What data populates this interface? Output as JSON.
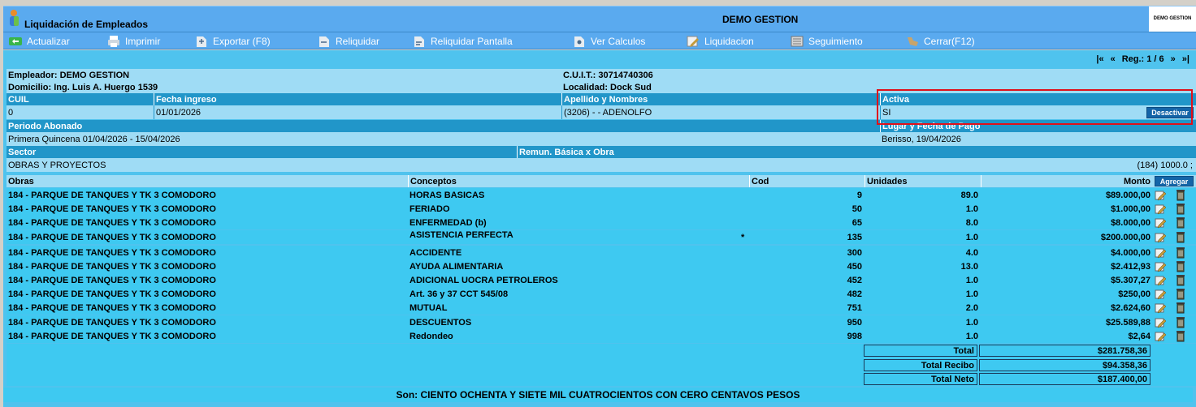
{
  "header": {
    "app_title": "Liquidación de Empleados",
    "company": "DEMO GESTION",
    "brand": "DEMO GESTION"
  },
  "toolbar": {
    "items": [
      {
        "label": "Actualizar",
        "icon": "refresh-icon"
      },
      {
        "label": "Imprimir",
        "icon": "print-icon"
      },
      {
        "label": "Exportar (F8)",
        "icon": "export-icon"
      },
      {
        "label": "Reliquidar",
        "icon": "reliquidar-icon"
      },
      {
        "label": "Reliquidar Pantalla",
        "icon": "reliquidar-screen-icon"
      },
      {
        "label": "Ver Calculos",
        "icon": "calc-icon"
      },
      {
        "label": "Liquidacion",
        "icon": "edit-icon"
      },
      {
        "label": "Seguimiento",
        "icon": "tracking-icon"
      },
      {
        "label": "Cerrar(F12)",
        "icon": "close-icon"
      }
    ]
  },
  "nav": {
    "first": "|«",
    "prev": "«",
    "reg_label": "Reg.: 1 / 6",
    "next": "»",
    "last": "»|"
  },
  "employer": {
    "empleador": "Empleador: DEMO GESTION",
    "domicilio": "Domicilio: Ing. Luis A. Huergo 1539",
    "cuit": "C.U.I.T.: 30714740306",
    "localidad": "Localidad: Dock Sud"
  },
  "employee": {
    "cuil_label": "CUIL",
    "fecha_label": "Fecha ingreso",
    "nombre_label": "Apellido y Nombres",
    "activa_label": "Activa",
    "cuil": "0",
    "fecha": "01/01/2026",
    "nombre": "(3206) - - ADENOLFO",
    "activa": "SI",
    "desactivar": "Desactivar"
  },
  "period": {
    "periodo_label": "Periodo Abonado",
    "lugar_label": "Lugar y Fecha de Pago",
    "periodo": "Primera Quincena 01/04/2026 - 15/04/2026",
    "lugar": "Berisso, 19/04/2026"
  },
  "sector": {
    "sector_label": "Sector",
    "remun_label": "Remun. Básica x Obra",
    "sector": "OBRAS Y PROYECTOS",
    "remun": "(184) 1000.0 ;"
  },
  "table": {
    "headers": {
      "obras": "Obras",
      "conceptos": "Conceptos",
      "cod": "Cod",
      "unidades": "Unidades",
      "monto": "Monto"
    },
    "add_button": "Agregar",
    "rows": [
      {
        "obra": "184 - PARQUE DE TANQUES Y TK 3 COMODORO",
        "concepto": "HORAS BASICAS",
        "cod": "9",
        "unidades": "89.0",
        "monto": "$89.000,00",
        "mark": ""
      },
      {
        "obra": "184 - PARQUE DE TANQUES Y TK 3 COMODORO",
        "concepto": "FERIADO",
        "cod": "50",
        "unidades": "1.0",
        "monto": "$1.000,00",
        "mark": ""
      },
      {
        "obra": "184 - PARQUE DE TANQUES Y TK 3 COMODORO",
        "concepto": "ENFERMEDAD (b)",
        "cod": "65",
        "unidades": "8.0",
        "monto": "$8.000,00",
        "mark": ""
      },
      {
        "obra": "184 - PARQUE DE TANQUES Y TK 3 COMODORO",
        "concepto": "ASISTENCIA PERFECTA",
        "cod": "135",
        "unidades": "1.0",
        "monto": "$200.000,00",
        "mark": "*"
      },
      {
        "obra": "184 - PARQUE DE TANQUES Y TK 3 COMODORO",
        "concepto": "ACCIDENTE",
        "cod": "300",
        "unidades": "4.0",
        "monto": "$4.000,00",
        "mark": ""
      },
      {
        "obra": "184 - PARQUE DE TANQUES Y TK 3 COMODORO",
        "concepto": "AYUDA ALIMENTARIA",
        "cod": "450",
        "unidades": "13.0",
        "monto": "$2.412,93",
        "mark": ""
      },
      {
        "obra": "184 - PARQUE DE TANQUES Y TK 3 COMODORO",
        "concepto": "ADICIONAL UOCRA PETROLEROS",
        "cod": "452",
        "unidades": "1.0",
        "monto": "$5.307,27",
        "mark": ""
      },
      {
        "obra": "184 - PARQUE DE TANQUES Y TK 3 COMODORO",
        "concepto": "Art. 36 y 37 CCT 545/08",
        "cod": "482",
        "unidades": "1.0",
        "monto": "$250,00",
        "mark": ""
      },
      {
        "obra": "184 - PARQUE DE TANQUES Y TK 3 COMODORO",
        "concepto": "MUTUAL",
        "cod": "751",
        "unidades": "2.0",
        "monto": "$2.624,60",
        "mark": ""
      },
      {
        "obra": "184 - PARQUE DE TANQUES Y TK 3 COMODORO",
        "concepto": "DESCUENTOS",
        "cod": "950",
        "unidades": "1.0",
        "monto": "$25.589,88",
        "mark": ""
      },
      {
        "obra": "184 - PARQUE DE TANQUES Y TK 3 COMODORO",
        "concepto": "Redondeo",
        "cod": "998",
        "unidades": "1.0",
        "monto": "$2,64",
        "mark": ""
      }
    ]
  },
  "totals": {
    "total_label": "Total",
    "total": "$281.758,36",
    "recibo_label": "Total Recibo",
    "recibo": "$94.358,36",
    "neto_label": "Total Neto",
    "neto": "$187.400,00"
  },
  "son": "Son:  CIENTO OCHENTA Y SIETE MIL CUATROCIENTOS CON CERO CENTAVOS   PESOS"
}
